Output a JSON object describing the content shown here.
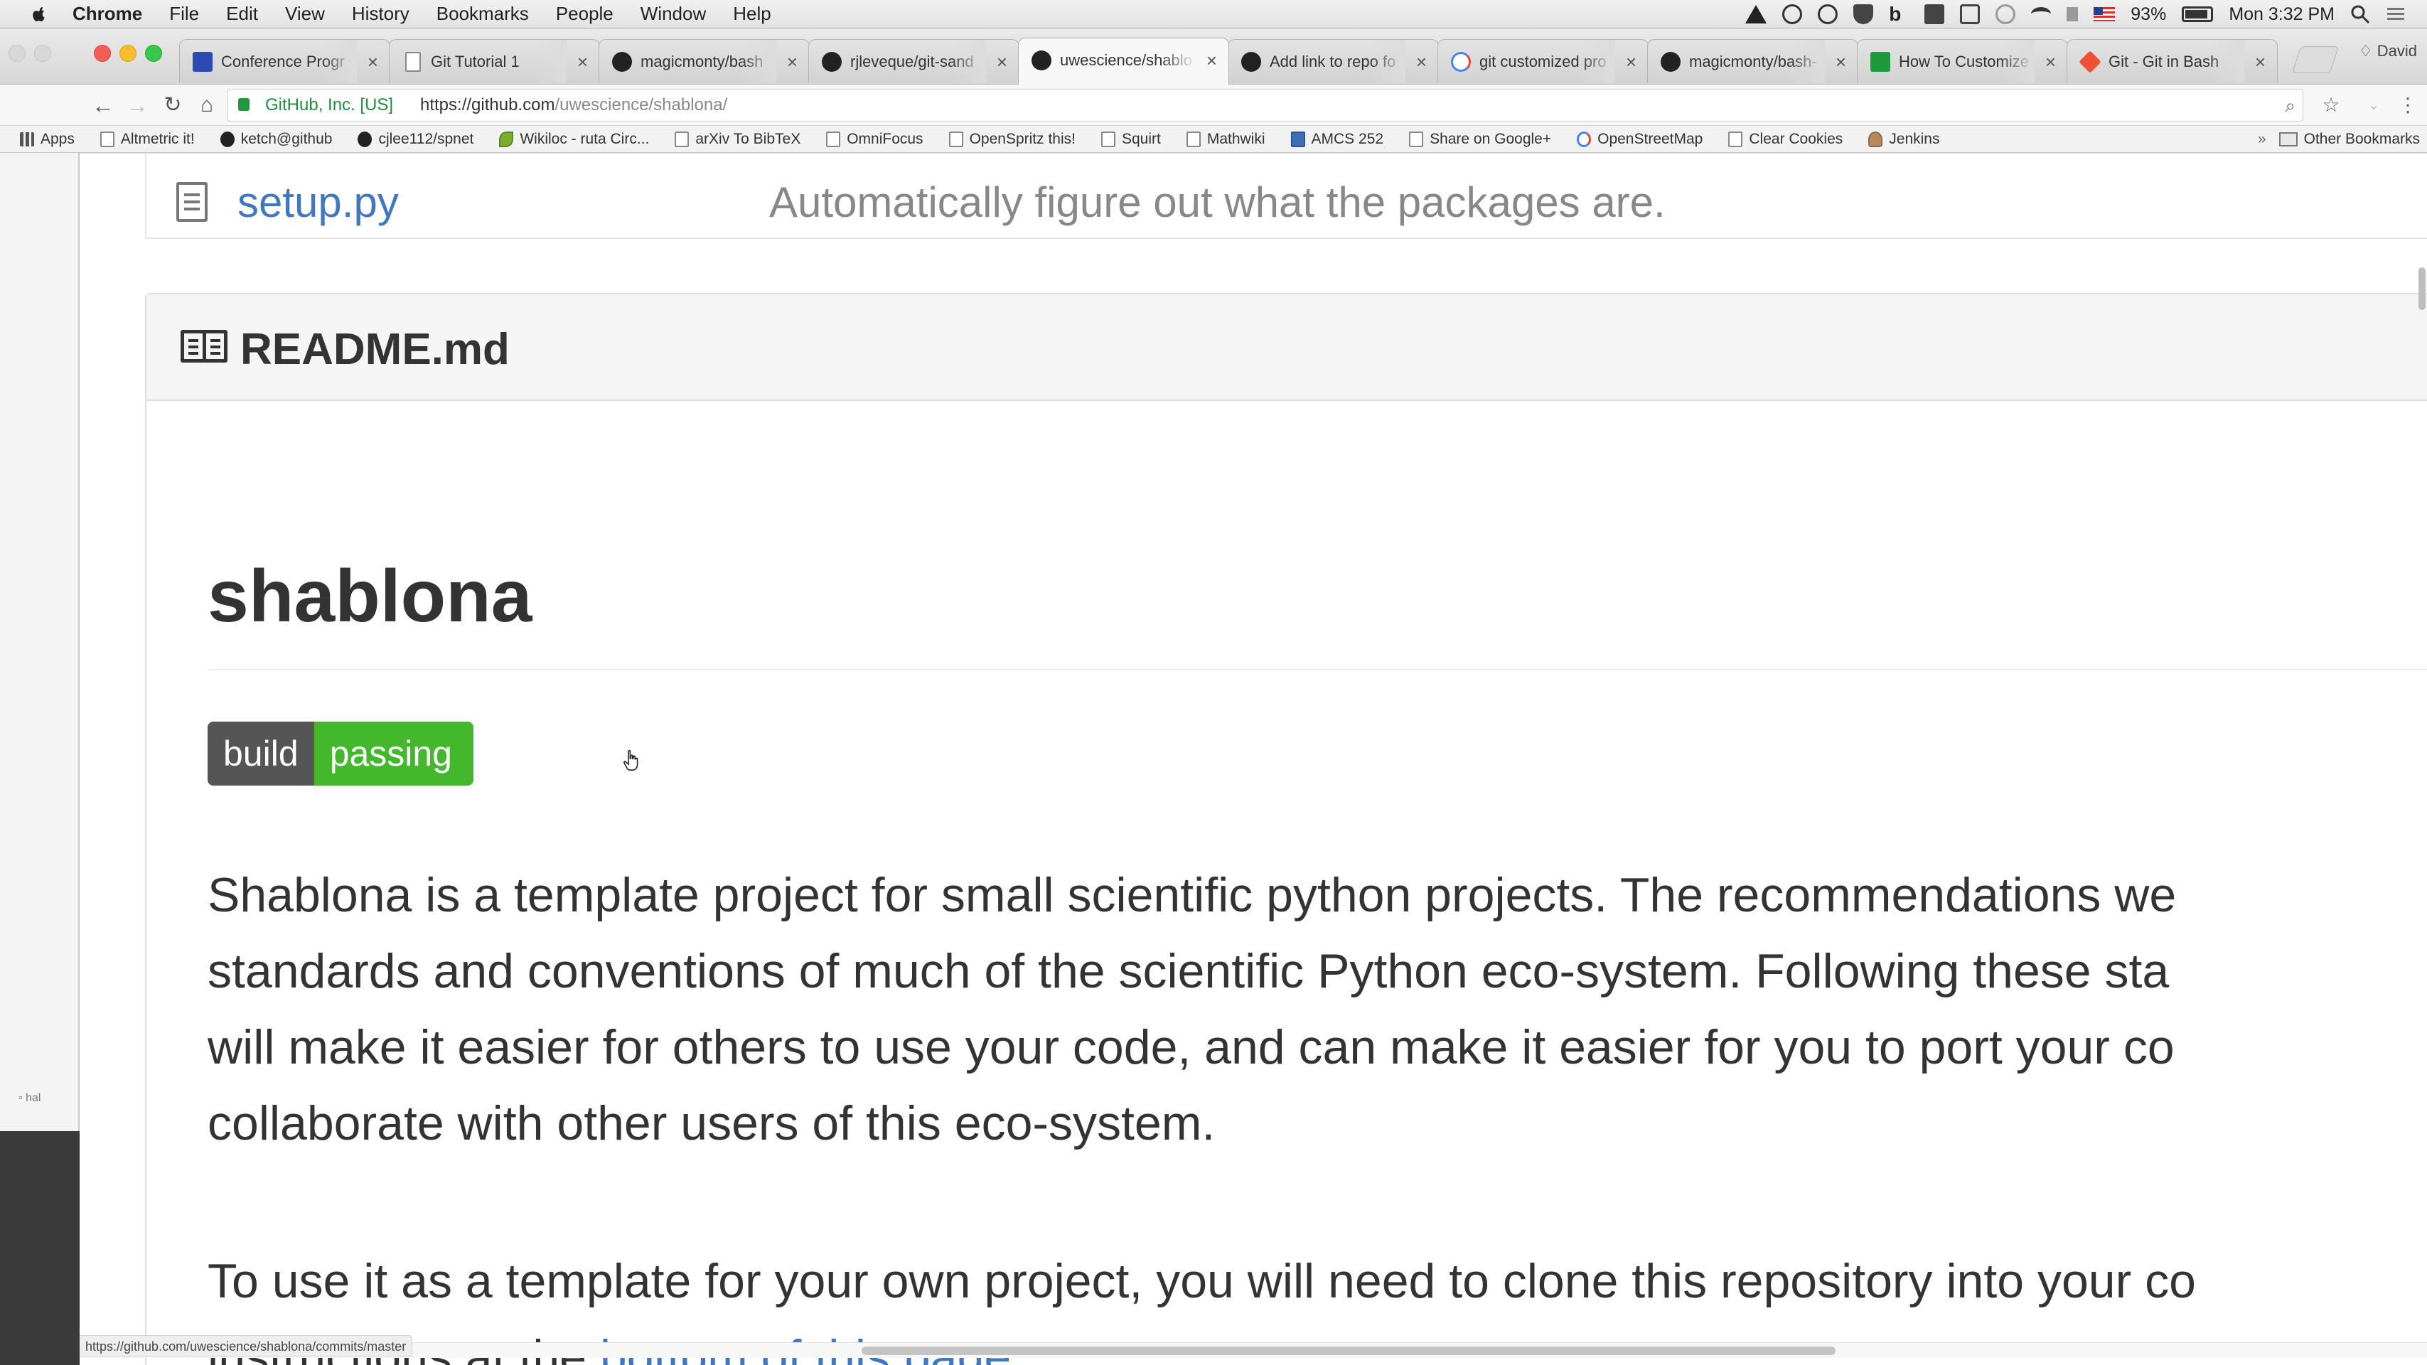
{
  "menubar": {
    "app": "Chrome",
    "items": [
      "File",
      "Edit",
      "View",
      "History",
      "Bookmarks",
      "People",
      "Window",
      "Help"
    ],
    "battery_percent": "93%",
    "clock": "Mon 3:32 PM"
  },
  "tabs": [
    {
      "title": "Conference Progr",
      "icon": "conference-icon",
      "active": false
    },
    {
      "title": "Git Tutorial 1",
      "icon": "document-icon",
      "active": false
    },
    {
      "title": "magicmonty/bash",
      "icon": "github-icon",
      "active": false
    },
    {
      "title": "rjleveque/git-sand",
      "icon": "github-icon",
      "active": false
    },
    {
      "title": "uwescience/shablo",
      "icon": "github-icon",
      "active": true
    },
    {
      "title": "Add link to repo fo",
      "icon": "github-icon",
      "active": false
    },
    {
      "title": "git customized pro",
      "icon": "google-icon",
      "active": false
    },
    {
      "title": "magicmonty/bash-",
      "icon": "github-icon",
      "active": false
    },
    {
      "title": "How To Customize",
      "icon": "green-square-icon",
      "active": false
    },
    {
      "title": "Git - Git in Bash",
      "icon": "git-icon",
      "active": false
    }
  ],
  "profile_name": "David",
  "address_bar": {
    "secure_label": "GitHub, Inc. [US]",
    "url_prefix": "https://github.com",
    "url_path": "/uwescience/shablona/"
  },
  "bookmarks": [
    {
      "label": "Apps",
      "icon": "apps-grid-icon"
    },
    {
      "label": "Altmetric it!",
      "icon": "bookmark-page-icon"
    },
    {
      "label": "ketch@github",
      "icon": "github-icon"
    },
    {
      "label": "cjlee112/spnet",
      "icon": "github-icon"
    },
    {
      "label": "Wikiloc - ruta Circ...",
      "icon": "leaf-icon"
    },
    {
      "label": "arXiv To BibTeX",
      "icon": "bookmark-page-icon"
    },
    {
      "label": "OmniFocus",
      "icon": "bookmark-page-icon"
    },
    {
      "label": "OpenSpritz this!",
      "icon": "bookmark-page-icon"
    },
    {
      "label": "Squirt",
      "icon": "bookmark-page-icon"
    },
    {
      "label": "Mathwiki",
      "icon": "bookmark-page-icon"
    },
    {
      "label": "AMCS 252",
      "icon": "blue-square-icon"
    },
    {
      "label": "Share on Google+",
      "icon": "bookmark-page-icon"
    },
    {
      "label": "OpenStreetMap",
      "icon": "google-icon"
    },
    {
      "label": "Clear Cookies",
      "icon": "bookmark-page-icon"
    },
    {
      "label": "Jenkins",
      "icon": "jenkins-icon"
    }
  ],
  "other_bookmarks": "Other Bookmarks",
  "file_row": {
    "name": "setup.py",
    "message": "Automatically figure out what the packages are."
  },
  "readme": {
    "title": "README.md",
    "heading": "shablona",
    "badge": {
      "left": "build",
      "right": "passing"
    },
    "paragraph1_lines": [
      "Shablona is a template project for small scientific python projects. The recommendations we",
      "standards and conventions of much of the scientific Python eco-system. Following these sta",
      "will make it easier for others to use your code, and can make it easier for you to port your co",
      "collaborate with other users of this eco-system."
    ],
    "paragraph2_line1": "To use it as a template for your own project, you will need to clone this repository into your co",
    "paragraph2_prefix": "instructions at the ",
    "paragraph2_link": "bottom of this page",
    "paragraph2_suffix": "."
  },
  "status_url": "https://github.com/uwescience/shablona/commits/master",
  "colors": {
    "link": "#4078c0",
    "badge_left": "#555555",
    "badge_right": "#44b82d"
  }
}
